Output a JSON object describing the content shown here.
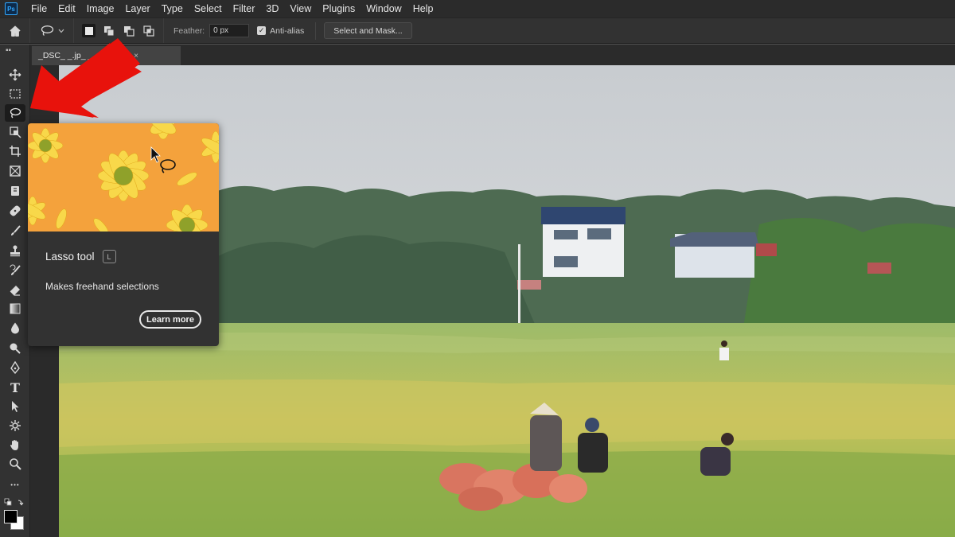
{
  "menubar": {
    "logo": "Ps",
    "items": [
      "File",
      "Edit",
      "Image",
      "Layer",
      "Type",
      "Select",
      "Filter",
      "3D",
      "View",
      "Plugins",
      "Window",
      "Help"
    ]
  },
  "options": {
    "home_icon": "home-icon",
    "tool_icon": "lasso-icon",
    "feather_label": "Feather:",
    "feather_value": "0 px",
    "antialias_label": "Anti-alias",
    "antialias_checked": true,
    "select_mask_label": "Select and Mask..."
  },
  "document": {
    "tab_title": "_DSC_ _.jp_ _ _RGB/8)",
    "tab_close": "×"
  },
  "toolbar": {
    "tools": [
      {
        "name": "move-tool",
        "icon": "move-icon"
      },
      {
        "name": "marquee-tool",
        "icon": "marquee-icon"
      },
      {
        "name": "lasso-tool",
        "icon": "lasso-icon",
        "active": true
      },
      {
        "name": "object-selection-tool",
        "icon": "object-selection-icon"
      },
      {
        "name": "crop-tool",
        "icon": "crop-icon"
      },
      {
        "name": "frame-tool",
        "icon": "frame-icon"
      },
      {
        "name": "eyedropper-tool",
        "icon": "eyedropper-icon"
      },
      {
        "name": "healing-brush-tool",
        "icon": "bandage-icon"
      },
      {
        "name": "brush-tool",
        "icon": "brush-icon"
      },
      {
        "name": "clone-stamp-tool",
        "icon": "stamp-icon"
      },
      {
        "name": "history-brush-tool",
        "icon": "history-brush-icon"
      },
      {
        "name": "eraser-tool",
        "icon": "eraser-icon"
      },
      {
        "name": "gradient-tool",
        "icon": "gradient-icon"
      },
      {
        "name": "blur-tool",
        "icon": "drop-icon"
      },
      {
        "name": "dodge-tool",
        "icon": "dodge-icon"
      },
      {
        "name": "pen-tool",
        "icon": "pen-icon"
      },
      {
        "name": "type-tool",
        "icon": "type-icon"
      },
      {
        "name": "path-selection-tool",
        "icon": "arrow-cursor-icon"
      },
      {
        "name": "shape-tool",
        "icon": "shape-icon"
      },
      {
        "name": "hand-tool",
        "icon": "hand-icon"
      },
      {
        "name": "zoom-tool",
        "icon": "zoom-icon"
      },
      {
        "name": "more-tools",
        "icon": "more-icon"
      }
    ],
    "type_glyph": "T",
    "more_glyph": "•••",
    "foreground_color": "#000000",
    "background_color": "#ffffff"
  },
  "tooltip": {
    "title": "Lasso tool",
    "shortcut": "L",
    "description": "Makes freehand selections",
    "learn_more": "Learn more"
  },
  "colors": {
    "accent_red": "#e8120c",
    "panel_dark": "#323232",
    "menubar": "#2b2b2b"
  }
}
